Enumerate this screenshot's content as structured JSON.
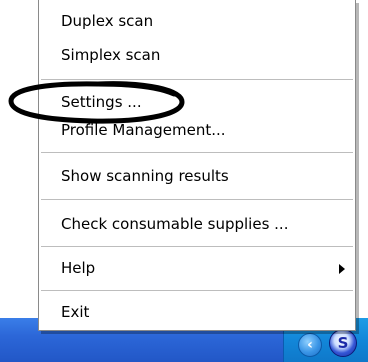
{
  "menu": {
    "items": [
      {
        "label": "Duplex scan"
      },
      {
        "label": "Simplex scan"
      },
      {
        "label": "Settings ..."
      },
      {
        "label": "Profile Management..."
      },
      {
        "label": "Show scanning results"
      },
      {
        "label": "Check consumable supplies ..."
      },
      {
        "label": "Help",
        "submenu": true
      },
      {
        "label": "Exit"
      }
    ]
  },
  "tray": {
    "chevron_glyph": "‹",
    "scanner_glyph": "S",
    "icons": [
      "chevron-left-icon",
      "scanner-tray-icon"
    ]
  },
  "colors": {
    "taskbar": "#2c67d8",
    "tray": "#1287d9",
    "annotation": "#000000"
  }
}
